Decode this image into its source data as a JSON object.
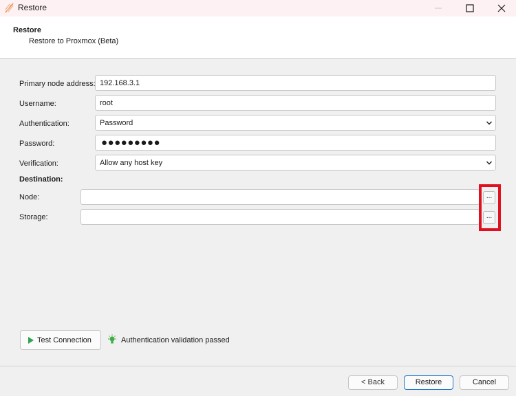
{
  "window": {
    "title": "Restore"
  },
  "header": {
    "title": "Restore",
    "subtitle": "Restore to Proxmox (Beta)"
  },
  "form": {
    "primary_node": {
      "label": "Primary node address:",
      "value": "192.168.3.1"
    },
    "username": {
      "label": "Username:",
      "value": "root"
    },
    "authentication": {
      "label": "Authentication:",
      "value": "Password"
    },
    "password": {
      "label": "Password:",
      "value": "●●●●●●●●●"
    },
    "verification": {
      "label": "Verification:",
      "value": "Allow any host key"
    },
    "destination": {
      "heading": "Destination:",
      "node": {
        "label": "Node:",
        "value": "",
        "browse_label": "..."
      },
      "storage": {
        "label": "Storage:",
        "value": "",
        "browse_label": "..."
      }
    }
  },
  "test": {
    "button_label": "Test Connection",
    "status": "Authentication validation passed"
  },
  "footer": {
    "back": "< Back",
    "restore": "Restore",
    "cancel": "Cancel"
  },
  "colors": {
    "highlight": "#e01020",
    "accent": "#1b73c8",
    "status_icon": "#3cb043",
    "play_icon": "#2da44e"
  },
  "icons": {
    "app": "feather-icon",
    "minimize": "minimize-icon",
    "maximize": "maximize-icon",
    "close": "close-icon",
    "dropdown": "chevron-down-icon",
    "play": "play-icon",
    "status": "lightbulb-icon"
  }
}
